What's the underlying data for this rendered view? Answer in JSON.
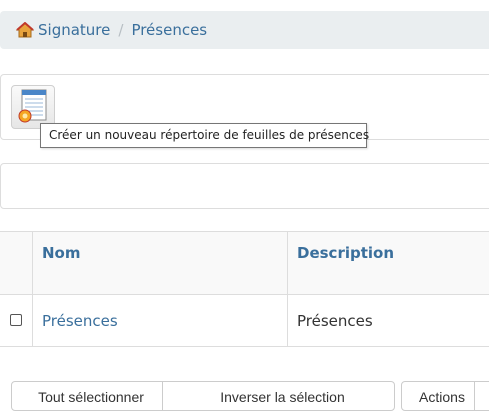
{
  "breadcrumb": {
    "home_label": "Signature",
    "separator": "/",
    "current": "Présences"
  },
  "toolbar": {
    "new_folder_tooltip": "Créer un nouveau répertoire de feuilles de présences"
  },
  "grid": {
    "columns": {
      "name": "Nom",
      "description": "Description"
    },
    "rows": [
      {
        "name": "Présences",
        "description": "Présences"
      }
    ]
  },
  "footer": {
    "select_all": "Tout sélectionner",
    "invert_selection": "Inverser la sélection",
    "actions": "Actions"
  },
  "colors": {
    "link": "#3a6f9c",
    "breadcrumb_bg": "#eaeef0",
    "border": "#dddddd"
  }
}
